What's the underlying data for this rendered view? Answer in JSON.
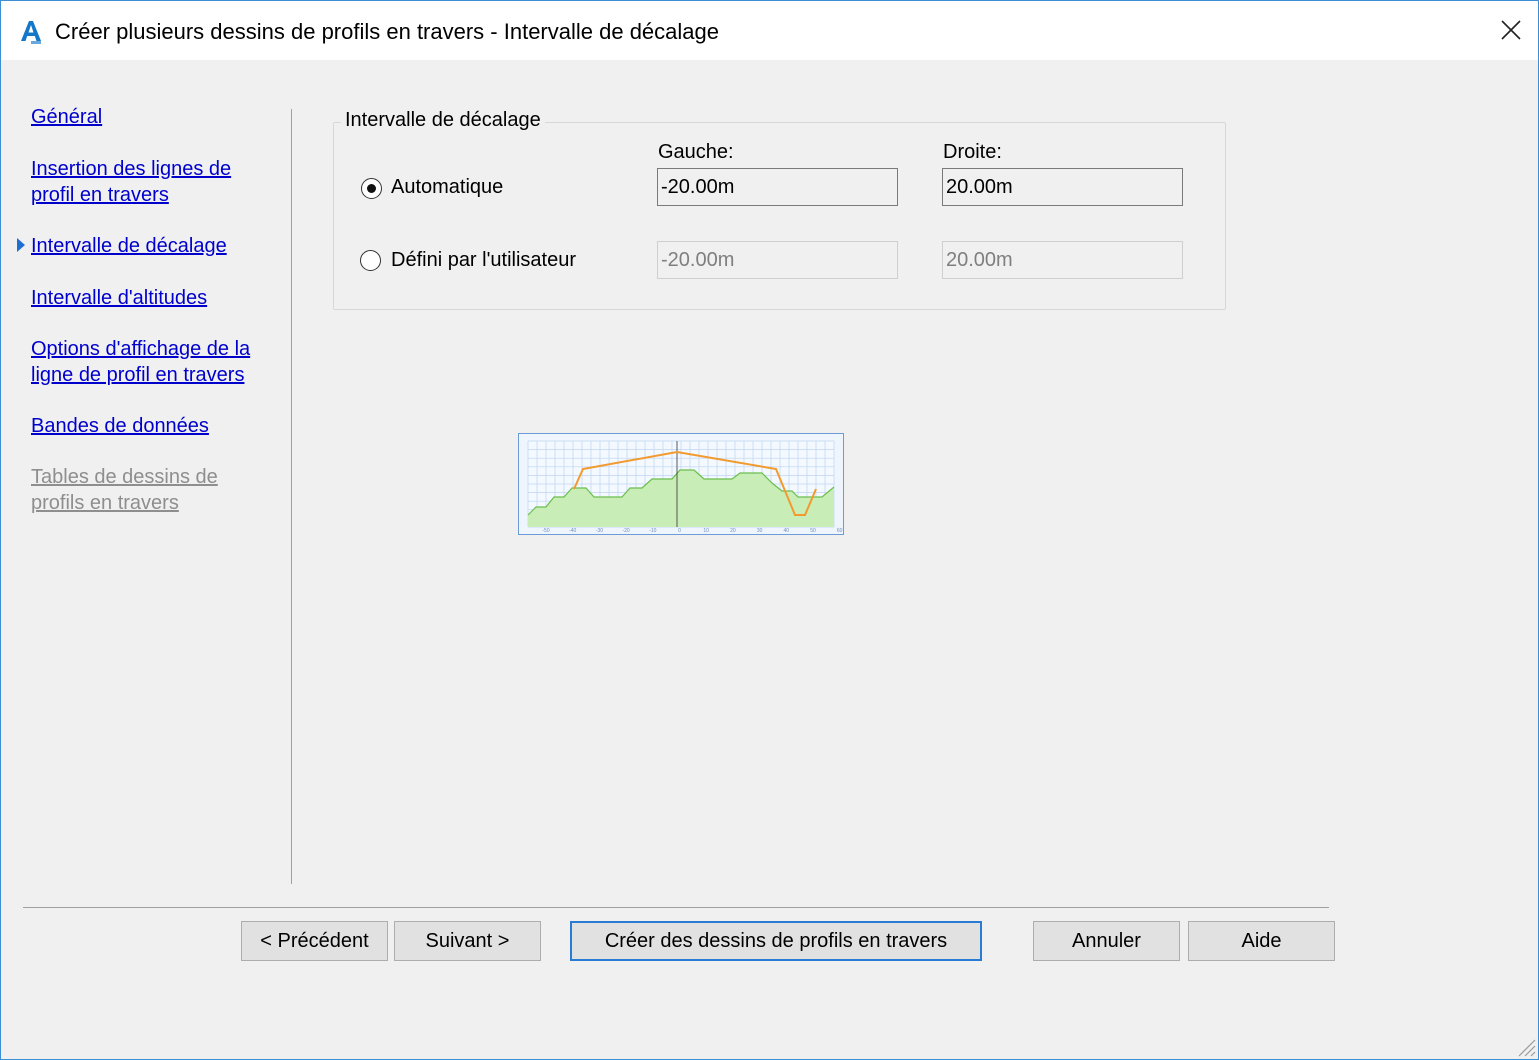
{
  "window": {
    "title": "Créer plusieurs dessins de profils en travers - Intervalle de décalage"
  },
  "nav": {
    "items": [
      {
        "lines": [
          "Général"
        ],
        "state": "link"
      },
      {
        "lines": [
          "Insertion des lignes de",
          "profil en travers"
        ],
        "state": "link"
      },
      {
        "lines": [
          "Intervalle de décalage"
        ],
        "state": "current"
      },
      {
        "lines": [
          "Intervalle d'altitudes"
        ],
        "state": "link"
      },
      {
        "lines": [
          "Options d'affichage de la",
          "ligne de profil en travers"
        ],
        "state": "link"
      },
      {
        "lines": [
          "Bandes de données"
        ],
        "state": "link"
      },
      {
        "lines": [
          "Tables de dessins de",
          "profils en travers"
        ],
        "state": "disabled"
      }
    ]
  },
  "offset_range": {
    "group_title": "Intervalle de décalage",
    "left_label": "Gauche:",
    "right_label": "Droite:",
    "automatic": {
      "label": "Automatique",
      "selected": true,
      "left_value": "-20.00m",
      "right_value": "20.00m"
    },
    "user_defined": {
      "label": "Défini par l'utilisateur",
      "selected": false,
      "left_value": "-20.00m",
      "right_value": "20.00m"
    }
  },
  "preview": {
    "tick_labels": [
      "-50",
      "-40",
      "-30",
      "-20",
      "-10",
      "0",
      "10",
      "20",
      "30",
      "40",
      "50",
      "60"
    ],
    "colors": {
      "background": "#f3f9ff",
      "grid": "#bfd4f2",
      "frame": "#6c9bd8",
      "ground_fill": "#c9edb6",
      "ground_line": "#6bbf4e",
      "design_line": "#f29a2e",
      "centerline": "#333333"
    }
  },
  "buttons": {
    "previous": "< Précédent",
    "next": "Suivant >",
    "create": "Créer des dessins de profils en travers",
    "cancel": "Annuler",
    "help": "Aide"
  },
  "icons": {
    "app": "autocad-civil3d-icon",
    "close": "close-icon",
    "current_step": "triangle-right-icon",
    "resize": "resize-grip-icon"
  }
}
